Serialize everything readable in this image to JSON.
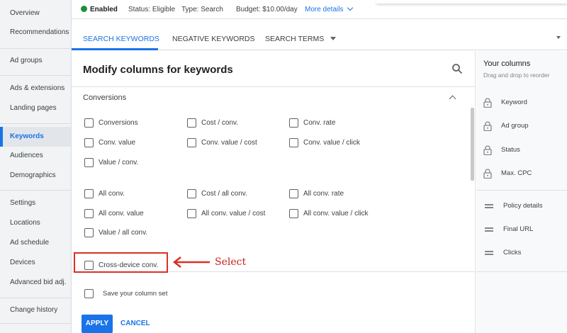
{
  "sidebar": {
    "items": [
      "Overview",
      "Recommendations",
      "Ad groups",
      "Ads & extensions",
      "Landing pages",
      "Keywords",
      "Audiences",
      "Demographics",
      "Settings",
      "Locations",
      "Ad schedule",
      "Devices",
      "Advanced bid adj.",
      "Change history"
    ],
    "active": "Keywords"
  },
  "status_bar": {
    "status": "Enabled",
    "status_field": "Status: Eligible",
    "type_field": "Type: Search",
    "budget_field": "Budget: $10.00/day",
    "more_details": "More details"
  },
  "tabs": [
    "SEARCH KEYWORDS",
    "NEGATIVE KEYWORDS",
    "SEARCH TERMS"
  ],
  "modal": {
    "title": "Modify columns for keywords",
    "section": "Conversions",
    "options": [
      "Conversions",
      "Cost / conv.",
      "Conv. rate",
      "Conv. value",
      "Conv. value / cost",
      "Conv. value / click",
      "Value / conv.",
      "All conv.",
      "Cost / all conv.",
      "All conv. rate",
      "All conv. value",
      "All conv. value / cost",
      "All conv. value / click",
      "Value / all conv.",
      "Cross-device conv."
    ],
    "annotation": "Select",
    "save_label": "Save your column set",
    "apply": "APPLY",
    "cancel": "CANCEL"
  },
  "your_columns": {
    "title": "Your columns",
    "subtitle": "Drag and drop to reorder",
    "locked": [
      "Keyword",
      "Ad group",
      "Status",
      "Max. CPC"
    ],
    "movable": [
      "Policy details",
      "Final URL",
      "Clicks"
    ]
  },
  "icons": [
    "search-icon",
    "lock-icon",
    "drag-handle-icon",
    "chevron-up-icon",
    "dropdown-arrow-icon",
    "arrow-icon"
  ],
  "colors": {
    "accent": "#1a73e8",
    "enabled": "#1e8e3e",
    "annotation": "#d93025"
  }
}
